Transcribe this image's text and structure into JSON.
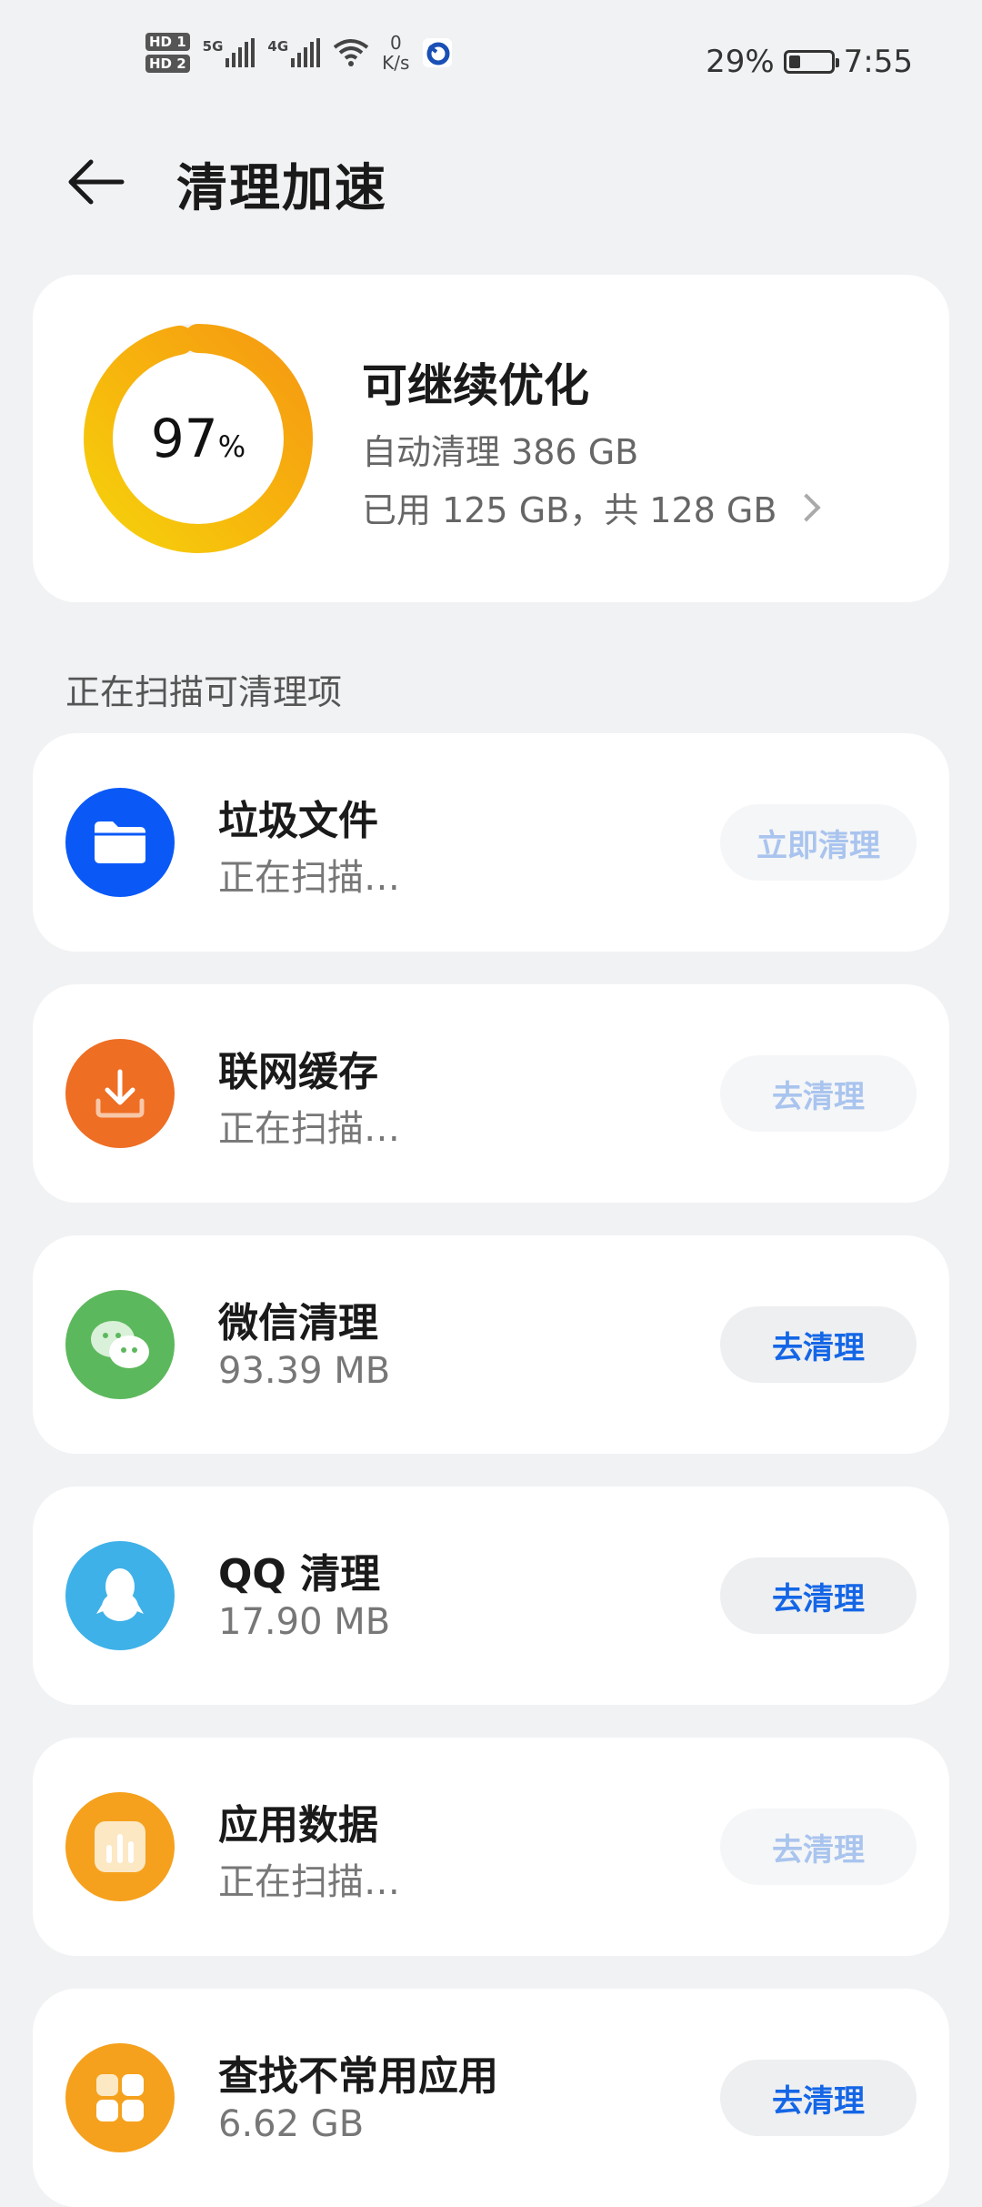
{
  "status_bar": {
    "hd1": "HD 1",
    "hd2": "HD 2",
    "net1": "5G",
    "net2": "4G",
    "speed_value": "0",
    "speed_unit": "K/s",
    "battery_text": "29%",
    "battery_level": 0.29,
    "time": "7:55"
  },
  "header": {
    "title": "清理加速"
  },
  "summary": {
    "percent": "97",
    "percent_symbol": "%",
    "usage_fraction": 0.97,
    "title": "可继续优化",
    "auto_clean": "自动清理 386 GB",
    "storage": "已用 125 GB，共 128 GB"
  },
  "section_label": "正在扫描可清理项",
  "items": [
    {
      "name": "垃圾文件",
      "sub": "正在扫描…",
      "button": "立即清理",
      "icon": "folder-icon",
      "color": "#0a59f7"
    },
    {
      "name": "联网缓存",
      "sub": "正在扫描…",
      "button": "去清理",
      "icon": "download-icon",
      "color": "#ee6e24"
    },
    {
      "name": "微信清理",
      "sub": "93.39 MB",
      "button": "去清理",
      "icon": "wechat-icon",
      "color": "#5cb85c"
    },
    {
      "name": "QQ 清理",
      "sub": "17.90 MB",
      "button": "去清理",
      "icon": "qq-icon",
      "color": "#3eb1e8"
    },
    {
      "name": "应用数据",
      "sub": "正在扫描…",
      "button": "去清理",
      "icon": "app-data-icon",
      "color": "#f5a11d"
    },
    {
      "name": "查找不常用应用",
      "sub": "6.62 GB",
      "button": "去清理",
      "icon": "apps-grid-icon",
      "color": "#f5a11d"
    }
  ]
}
